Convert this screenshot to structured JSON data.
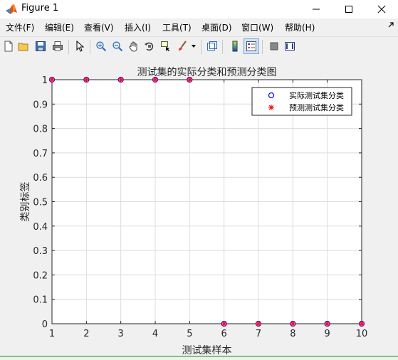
{
  "window": {
    "title": "Figure 1"
  },
  "menu": {
    "items": [
      "文件(F)",
      "编辑(E)",
      "查看(V)",
      "插入(I)",
      "工具(T)",
      "桌面(D)",
      "窗口(W)",
      "帮助(H)"
    ]
  },
  "toolbar": {
    "buttons": [
      "new-figure-icon",
      "open-file-icon",
      "save-icon",
      "print-icon",
      "pointer-icon",
      "zoom-in-icon",
      "zoom-out-icon",
      "pan-icon",
      "rotate-3d-icon",
      "data-cursor-icon",
      "brush-icon",
      "brush-dropdown-icon",
      "link-plot-icon",
      "colorbar-icon",
      "legend-icon",
      "hide-plot-tools-icon",
      "show-plot-tools-icon"
    ]
  },
  "colors": {
    "actual": "#0000ff",
    "predicted": "#ff0000",
    "grid": "#dcdcdc"
  },
  "chart_data": {
    "type": "scatter",
    "title": "测试集的实际分类和预测分类图",
    "xlabel": "测试集样本",
    "ylabel": "类别标签",
    "xlim": [
      1,
      10
    ],
    "ylim": [
      0,
      1
    ],
    "xticks": [
      1,
      2,
      3,
      4,
      5,
      6,
      7,
      8,
      9,
      10
    ],
    "yticks": [
      0,
      0.1,
      0.2,
      0.3,
      0.4,
      0.5,
      0.6,
      0.7,
      0.8,
      0.9,
      1
    ],
    "grid": true,
    "legend_position": "top-right",
    "series": [
      {
        "name": "实际测试集分类",
        "marker": "o",
        "color": "#0000ff",
        "x": [
          1,
          2,
          3,
          4,
          5,
          6,
          7,
          8,
          9,
          10
        ],
        "y": [
          1,
          1,
          1,
          1,
          1,
          0,
          0,
          0,
          0,
          0
        ]
      },
      {
        "name": "预测测试集分类",
        "marker": "*",
        "color": "#ff0000",
        "x": [
          1,
          2,
          3,
          4,
          5,
          6,
          7,
          8,
          9,
          10
        ],
        "y": [
          1,
          1,
          1,
          1,
          1,
          0,
          0,
          0,
          0,
          0
        ]
      }
    ]
  }
}
